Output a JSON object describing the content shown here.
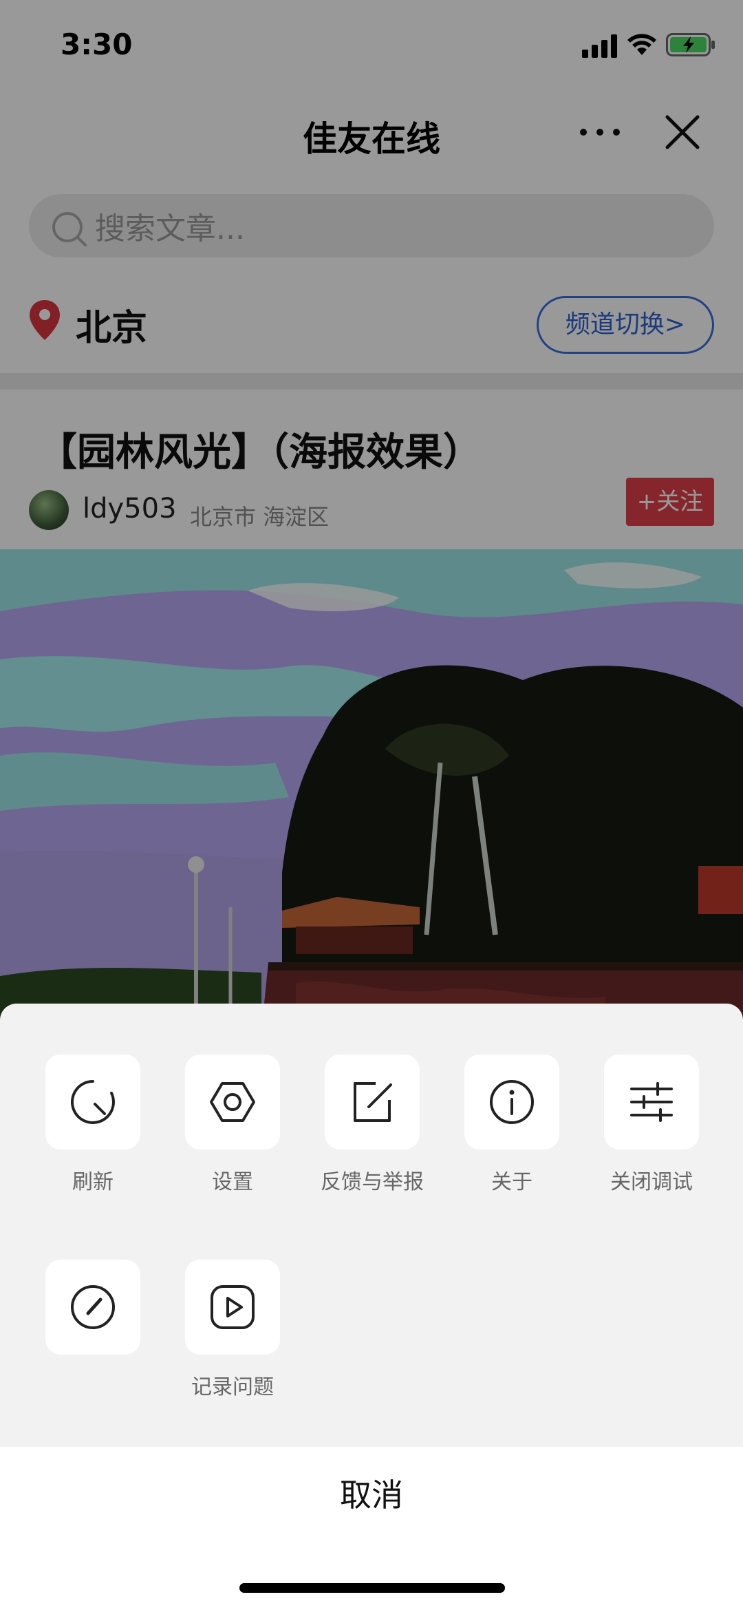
{
  "status_bar": {
    "time": "3:30"
  },
  "nav": {
    "title": "佳友在线"
  },
  "search": {
    "placeholder": "搜索文章..."
  },
  "location": {
    "city": "北京",
    "channel_switch": "频道切换>"
  },
  "article": {
    "title": "【园林风光】（海报效果）",
    "author": "ldy503",
    "author_location": "北京市 海淀区",
    "follow_label": "+关注"
  },
  "action_sheet": {
    "items": [
      {
        "label": "刷新",
        "icon": "refresh-icon"
      },
      {
        "label": "设置",
        "icon": "settings-icon"
      },
      {
        "label": "反馈与举报",
        "icon": "feedback-icon"
      },
      {
        "label": "关于",
        "icon": "info-icon"
      },
      {
        "label": "关闭调试",
        "icon": "sliders-icon"
      },
      {
        "label": "",
        "icon": "performance-gauge-icon"
      },
      {
        "label": "记录问题",
        "icon": "record-play-icon"
      }
    ],
    "cancel_label": "取消"
  },
  "colors": {
    "accent_blue": "#2f62cf",
    "follow_red": "#e0404a",
    "location_pin": "#d9363e",
    "overlay": "rgba(0,0,0,0.4)",
    "sheet_bg": "#f2f2f2"
  }
}
